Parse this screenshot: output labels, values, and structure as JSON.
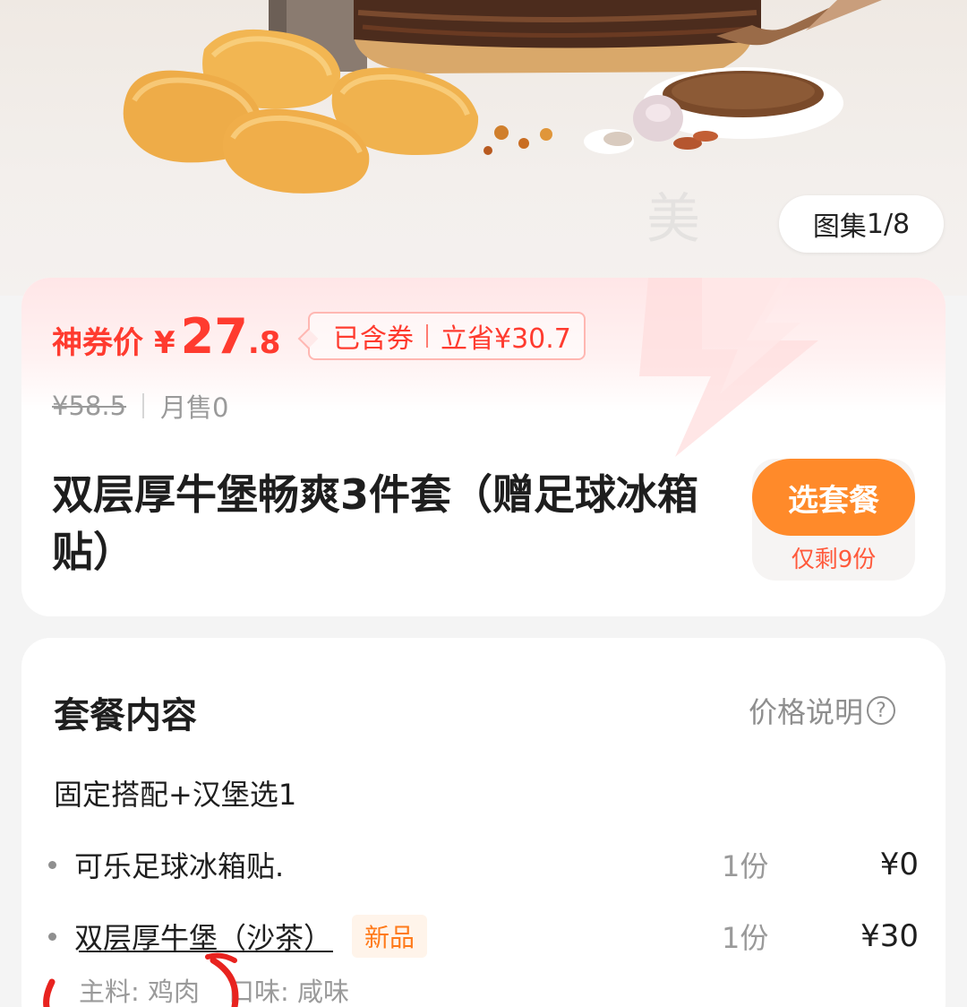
{
  "hero": {
    "gallery_label": "图集",
    "gallery_counter": "1/8",
    "watermark": "美"
  },
  "price_card": {
    "price_label": "神券价",
    "currency": "¥",
    "price_integer": "27",
    "price_decimal": ".8",
    "coupon_included": "已含券",
    "savings": "立省¥30.7",
    "original_price": "¥58.5",
    "monthly_sales": "月售0",
    "product_title": "双层厚牛堡畅爽3件套（赠足球冰箱贴）",
    "select_button": "选套餐",
    "stock_left": "仅剩9份"
  },
  "package": {
    "title": "套餐内容",
    "price_explain": "价格说明",
    "price_explain_icon": "question-circle-icon",
    "combo_rule": "固定搭配+汉堡选1",
    "items": [
      {
        "name": "可乐足球冰箱贴.",
        "qty": "1份",
        "price": "¥0",
        "tag": ""
      },
      {
        "name": "双层厚牛堡（沙茶）",
        "qty": "1份",
        "price": "¥30",
        "tag": "新品"
      }
    ],
    "detail_main": "主料: 鸡肉",
    "detail_flavor": "口味: 咸味"
  },
  "colors": {
    "accent_red": "#ff3b2f",
    "button_orange": "#ff8a2a",
    "annotation_red": "#e8231f"
  }
}
